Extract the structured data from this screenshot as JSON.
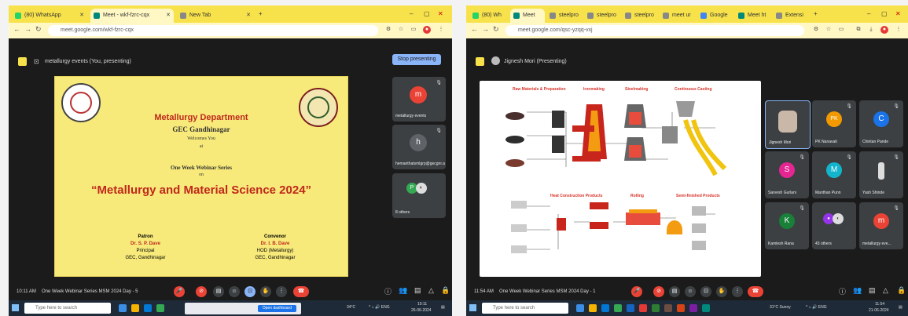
{
  "left": {
    "tabs": [
      {
        "label": "(80) WhatsApp",
        "color": "#25d366"
      },
      {
        "label": "Meet - wkf-fzrc-cqx",
        "color": "#00897b"
      },
      {
        "label": "New Tab",
        "color": "#888888"
      }
    ],
    "url": "meet.google.com/wkf-fzrc-cqx",
    "meet_title": "metallurgy events (You, presenting)",
    "stop_button": "Stop presenting",
    "slide": {
      "line1": "Metallurgy Department",
      "line2": "GEC Gandhinagar",
      "line3": "Welcomes You",
      "line4": "at",
      "line5": "One Week Webinar Series",
      "line6": "on",
      "line7": "“Metallurgy and Material Science 2024”",
      "patron_label": "Patron",
      "patron_name": "Dr. S. P. Dave",
      "patron_role": "Principal",
      "patron_org": "GEC, Gandhinagar",
      "convenor_label": "Convenor",
      "convenor_name": "Dr. I. B. Dave",
      "convenor_role": "HOD (Metallurgy)",
      "convenor_org": "GEC, Gandhinagar"
    },
    "participants": [
      {
        "initial": "m",
        "name": "metallurgy events",
        "color": "#ea4335"
      },
      {
        "initial": "h",
        "name": "hemanthatsmlgrp@gecgnr.ac...",
        "color": "#5f6368"
      },
      {
        "initial": "P",
        "name": "8 others",
        "color": "#34a853"
      }
    ],
    "time": "10:11 AM",
    "meeting": "One Week Webinar Series MSM 2024 Day - 5",
    "search_placeholder": "Type here to search",
    "weather": "34°C",
    "clock": "10:11",
    "date": "26-06-2024",
    "notify": "Open dashboard"
  },
  "right": {
    "tabs": [
      {
        "label": "(80) Wh",
        "color": "#25d366"
      },
      {
        "label": "Meet",
        "color": "#00897b"
      },
      {
        "label": "steelpro",
        "color": "#888888"
      },
      {
        "label": "steelpro",
        "color": "#888888"
      },
      {
        "label": "steelpro",
        "color": "#888888"
      },
      {
        "label": "meet ur",
        "color": "#888888"
      },
      {
        "label": "Google",
        "color": "#4285f4"
      },
      {
        "label": "Meet ht",
        "color": "#00897b"
      },
      {
        "label": "Extensi",
        "color": "#888888"
      }
    ],
    "url": "meet.google.com/qsc-yzqq-vxj",
    "meet_title": "Jignesh Mori (Presenting)",
    "flow_labels": {
      "raw": "Raw Materials & Preparation",
      "iron": "Ironmaking",
      "steel": "Steelmaking",
      "cast": "Continuous Casting",
      "hot": "Heat Construction Products",
      "roll": "Rolling",
      "semi": "Semi-finished Products"
    },
    "participants": [
      {
        "initial": "",
        "name": "Jignesh Mori",
        "color": "#8ab4f8"
      },
      {
        "initial": "PK",
        "name": "PK Nanavati",
        "color": "#f29900"
      },
      {
        "initial": "C",
        "name": "Chintan Pande",
        "color": "#1a73e8"
      },
      {
        "initial": "S",
        "name": "Sarvesh Gurlani",
        "color": "#e52592"
      },
      {
        "initial": "M",
        "name": "Manthan Punn",
        "color": "#12b5cb"
      },
      {
        "initial": "",
        "name": "Yash Shinde",
        "color": "#5f6368"
      },
      {
        "initial": "K",
        "name": "Kamlesh Rana",
        "color": "#188038"
      },
      {
        "initial": "",
        "name": "43 others",
        "color": "#9334e6"
      },
      {
        "initial": "m",
        "name": "metallurgy eve...",
        "color": "#ea4335"
      }
    ],
    "time": "11:54 AM",
    "meeting": "One Week Webinar Series MSM 2024 Day - 1",
    "search_placeholder": "Type here to search",
    "weather": "31°C Sunny",
    "clock": "11:54",
    "date": "21-06-2024"
  }
}
